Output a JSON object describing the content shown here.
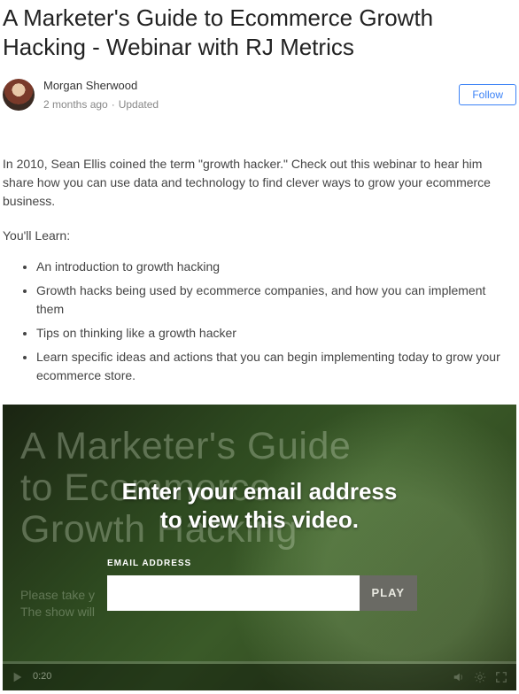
{
  "article": {
    "title": "A Marketer's Guide to Ecommerce Growth Hacking - Webinar with RJ Metrics",
    "author_name": "Morgan Sherwood",
    "posted": "2 months ago",
    "updated_label": "Updated",
    "follow_label": "Follow",
    "intro": "In 2010, Sean Ellis coined the term \"growth hacker.\" Check out this webinar to hear him share how you can use data and technology to find clever ways to grow your ecommerce business.",
    "learn_label": "You'll Learn:",
    "learn_items": [
      "An introduction to growth hacking",
      "Growth hacks being used by ecommerce companies, and how you can implement them",
      "Tips on thinking like a growth hacker",
      "Learn specific ideas and actions that you can begin implementing today to grow your ecommerce store."
    ]
  },
  "video": {
    "bg_title": "A Marketer's Guide\nto Ecommerce\nGrowth Hacking",
    "bg_subtitle": "Please take y\nThe show will",
    "prompt_line1": "Enter your email address",
    "prompt_line2": "to view this video.",
    "email_label": "EMAIL ADDRESS",
    "email_value": "",
    "play_label": "PLAY",
    "time_elapsed": "0:20"
  }
}
